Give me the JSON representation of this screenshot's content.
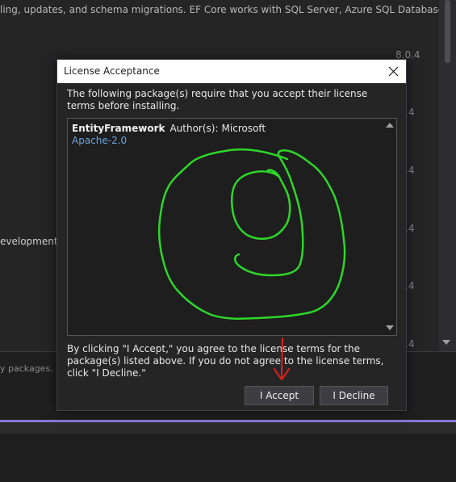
{
  "background": {
    "description_text": "ling, updates, and schema migrations. EF Core works with SQL Server, Azure SQL Database,",
    "versions": [
      "8.0.4",
      ".4",
      ".4",
      ".4",
      ".4",
      ".4",
      ".4"
    ],
    "partial_line": "evelopment a",
    "bottom_text": "y packages."
  },
  "dialog": {
    "title": "License Acceptance",
    "close_glyph": "✕",
    "intro": "The following package(s) require that you accept their license terms before installing.",
    "package": {
      "name": "EntityFramework",
      "authors_label": "Author(s):",
      "author": "Microsoft",
      "license": "Apache-2.0"
    },
    "notice": "By clicking \"I Accept,\" you agree to the license terms for the package(s) listed above. If you do not agree to the license terms, click \"I Decline.\"",
    "accept_label": "I Accept",
    "decline_label": "I Decline"
  },
  "annotations": {
    "scribble_color": "#2ed62a",
    "arrow_color": "#e0201c"
  },
  "colors": {
    "accent_line": "#8a76d4",
    "link": "#6aa5e0"
  }
}
